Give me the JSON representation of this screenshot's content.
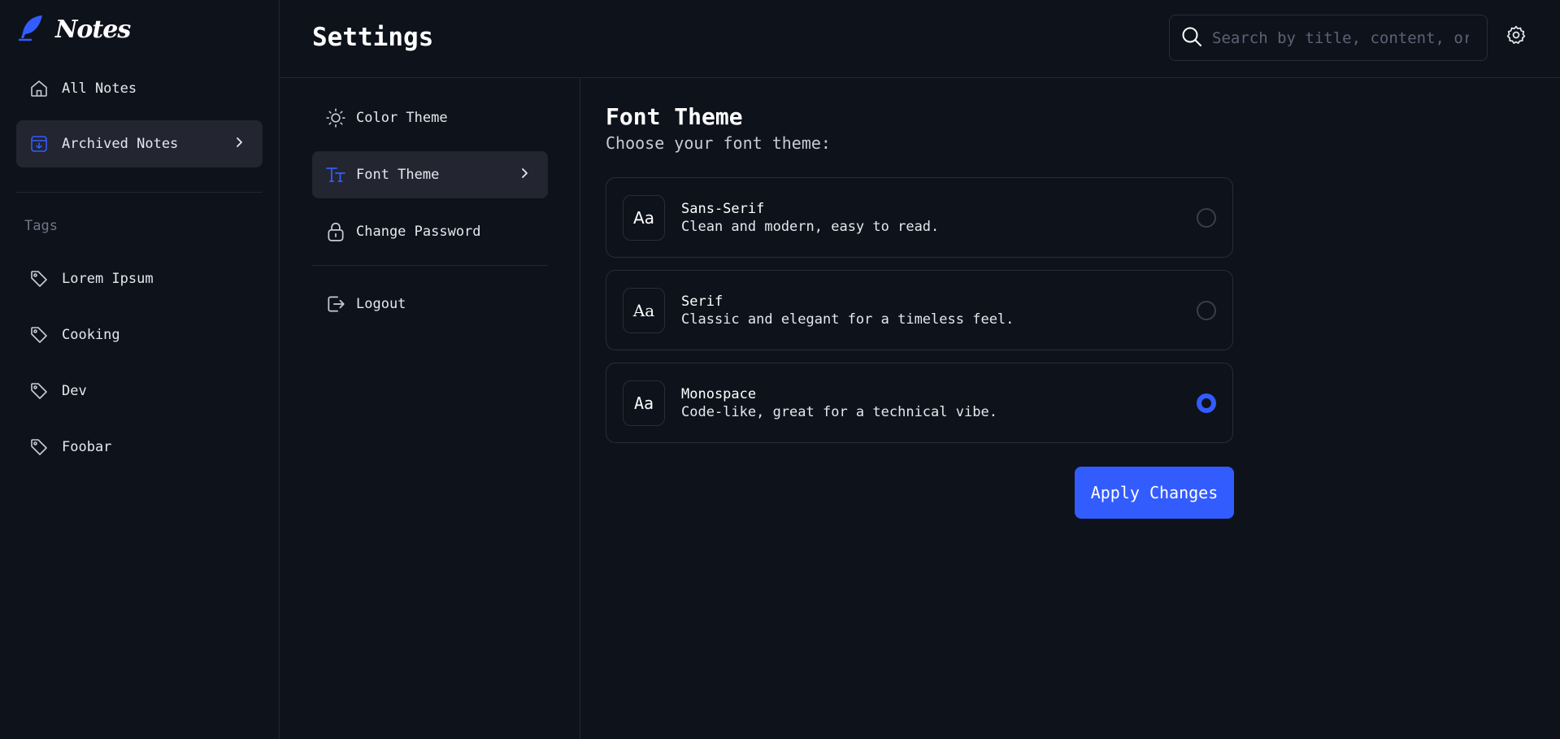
{
  "app": {
    "logo_text": "Notes"
  },
  "sidebar": {
    "items": [
      {
        "label": "All Notes",
        "icon": "home-icon",
        "active": false
      },
      {
        "label": "Archived Notes",
        "icon": "archive-icon",
        "active": true
      }
    ],
    "tags_heading": "Tags",
    "tags": [
      {
        "label": "Lorem Ipsum",
        "icon": "tag-icon"
      },
      {
        "label": "Cooking",
        "icon": "tag-icon"
      },
      {
        "label": "Dev",
        "icon": "tag-icon"
      },
      {
        "label": "Foobar",
        "icon": "tag-icon"
      }
    ]
  },
  "header": {
    "title": "Settings",
    "search_placeholder": "Search by title, content, or tags..."
  },
  "settings_menu": {
    "items": [
      {
        "label": "Color Theme",
        "icon": "sun-icon"
      },
      {
        "label": "Font Theme",
        "icon": "font-icon",
        "active": true
      },
      {
        "label": "Change Password",
        "icon": "lock-icon"
      },
      {
        "label": "Logout",
        "icon": "logout-icon"
      }
    ]
  },
  "content": {
    "title": "Font Theme",
    "subtitle": "Choose your font theme:",
    "options": [
      {
        "badge": "Aa",
        "name": "Sans-Serif",
        "desc": "Clean and modern, easy to read.",
        "selected": false
      },
      {
        "badge": "Aa",
        "name": "Serif",
        "desc": "Classic and elegant for a timeless feel.",
        "selected": false
      },
      {
        "badge": "Aa",
        "name": "Monospace",
        "desc": "Code-like, great for a technical vibe.",
        "selected": true
      }
    ],
    "apply_label": "Apply Changes"
  },
  "colors": {
    "accent": "#335cff",
    "background": "#0e121b",
    "active_bg": "#232530",
    "border": "#232632",
    "muted_text": "#70758a"
  }
}
